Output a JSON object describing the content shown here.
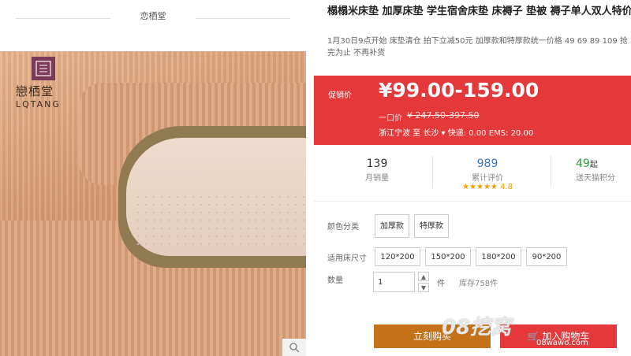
{
  "brand": {
    "header": "恋栖堂",
    "logo_cn": "戀栖堂",
    "logo_en": "LQTANG"
  },
  "product": {
    "title": "榻榻米床垫 加厚床垫 学生宿舍床垫 床褥子 垫被 褥子单人双人特价",
    "subtitle": "1月30日9点开始 床垫清仓 拍下立减50元 加厚款和特厚款统一价格 49 69 89 109 抢完为止 不再补货"
  },
  "pricing": {
    "promo_label": "促销价",
    "price": "¥99.00-159.00",
    "original_label": "一口价",
    "original_price": "¥ 247.50-397.50",
    "shipping": "浙江宁波 至 长沙 ▾ 快递: 0.00 EMS: 20.00"
  },
  "stats": {
    "monthly_sales": "139",
    "monthly_sales_label": "月销量",
    "reviews": "989",
    "reviews_label": "累计评价",
    "rating": "★★★★★ 4.8",
    "points": "49",
    "points_suffix": "起",
    "points_label": "送天猫积分"
  },
  "options": {
    "color_label": "颜色分类",
    "colors": [
      "加厚款",
      "特厚款"
    ],
    "size_label": "适用床尺寸",
    "sizes": [
      "120*200",
      "150*200",
      "180*200",
      "90*200"
    ],
    "qty_label": "数量",
    "qty_value": "1",
    "qty_unit": "件",
    "stock": "库存758件"
  },
  "actions": {
    "buy_now": "立刻购买",
    "add_cart": "加入购物车"
  },
  "watermark": {
    "main": "08挖窝",
    "sub": "08wawo.com"
  }
}
